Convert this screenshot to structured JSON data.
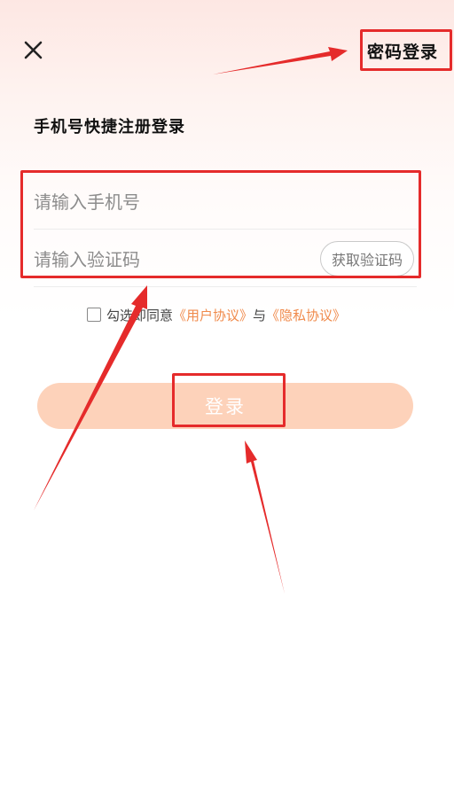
{
  "header": {
    "close_icon": "close-icon",
    "password_login_label": "密码登录"
  },
  "title": "手机号快捷注册登录",
  "form": {
    "phone_placeholder": "请输入手机号",
    "code_placeholder": "请输入验证码",
    "get_code_label": "获取验证码"
  },
  "agreement": {
    "prefix": "勾选即同意",
    "user_agreement": "《用户协议》",
    "conjunction": "与",
    "privacy_policy": "《隐私协议》"
  },
  "login_button_label": "登录",
  "colors": {
    "accent": "#f08a4b",
    "login_button_bg": "#fdd2ba",
    "annotation_red": "#e52b2b"
  }
}
